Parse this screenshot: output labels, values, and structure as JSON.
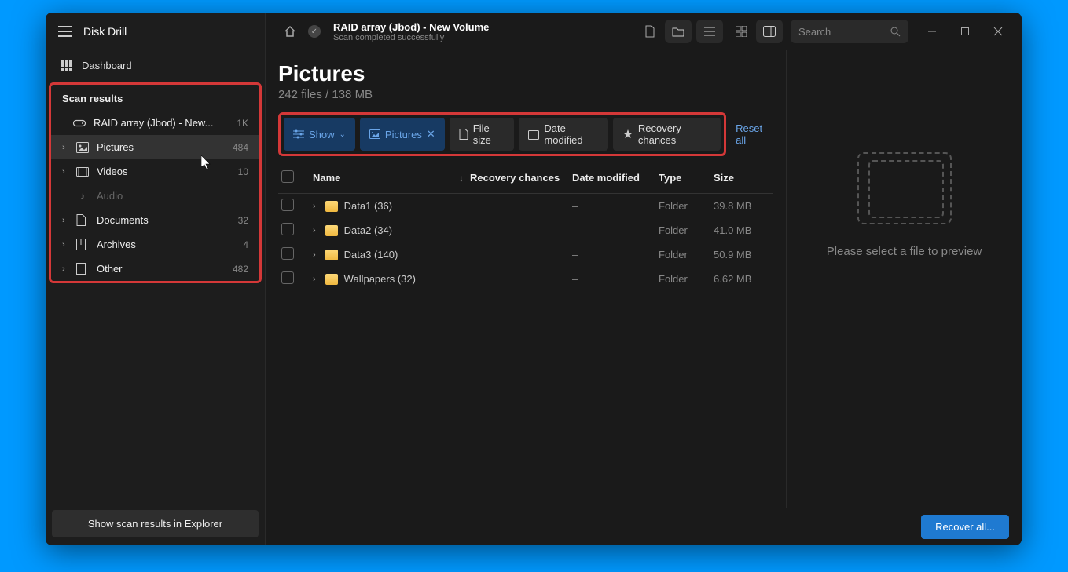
{
  "app_title": "Disk Drill",
  "sidebar": {
    "dashboard": "Dashboard",
    "section": "Scan results",
    "raid_item": "RAID array (Jbod) - New...",
    "raid_count": "1K",
    "items": [
      {
        "label": "Pictures",
        "count": "484"
      },
      {
        "label": "Videos",
        "count": "10"
      },
      {
        "label": "Audio",
        "count": ""
      },
      {
        "label": "Documents",
        "count": "32"
      },
      {
        "label": "Archives",
        "count": "4"
      },
      {
        "label": "Other",
        "count": "482"
      }
    ],
    "explorer_btn": "Show scan results in Explorer"
  },
  "titlebar": {
    "title": "RAID array (Jbod) - New Volume",
    "subtitle": "Scan completed successfully",
    "search_placeholder": "Search"
  },
  "page": {
    "title": "Pictures",
    "subtitle": "242 files / 138 MB"
  },
  "filters": {
    "show": "Show",
    "pictures": "Pictures",
    "file_size": "File size",
    "date_modified": "Date modified",
    "recovery": "Recovery chances",
    "reset": "Reset all"
  },
  "columns": {
    "name": "Name",
    "recovery": "Recovery chances",
    "date": "Date modified",
    "type": "Type",
    "size": "Size"
  },
  "rows": [
    {
      "name": "Data1 (36)",
      "recovery": "",
      "date": "–",
      "type": "Folder",
      "size": "39.8 MB"
    },
    {
      "name": "Data2 (34)",
      "recovery": "",
      "date": "–",
      "type": "Folder",
      "size": "41.0 MB"
    },
    {
      "name": "Data3 (140)",
      "recovery": "",
      "date": "–",
      "type": "Folder",
      "size": "50.9 MB"
    },
    {
      "name": "Wallpapers (32)",
      "recovery": "",
      "date": "–",
      "type": "Folder",
      "size": "6.62 MB"
    }
  ],
  "preview": {
    "text": "Please select a file to preview"
  },
  "footer": {
    "recover": "Recover all..."
  }
}
